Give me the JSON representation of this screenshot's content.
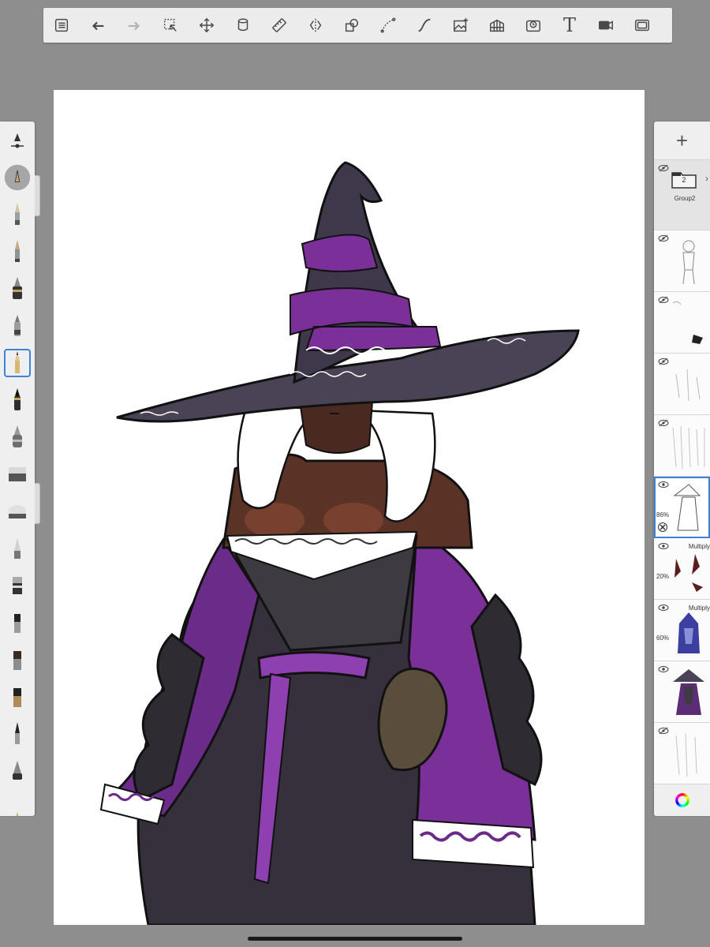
{
  "toolbar": {
    "buttons": [
      {
        "name": "gallery-button",
        "icon": "list-icon"
      },
      {
        "name": "undo-button",
        "icon": "undo-icon"
      },
      {
        "name": "redo-button",
        "icon": "redo-icon",
        "disabled": true
      },
      {
        "name": "selection-button",
        "icon": "selection-icon"
      },
      {
        "name": "transform-button",
        "icon": "move-icon"
      },
      {
        "name": "fill-button",
        "icon": "bucket-icon"
      },
      {
        "name": "ruler-button",
        "icon": "ruler-icon"
      },
      {
        "name": "symmetry-button",
        "icon": "symmetry-icon"
      },
      {
        "name": "shapes-button",
        "icon": "shapes-icon"
      },
      {
        "name": "curve-button",
        "icon": "curve-icon"
      },
      {
        "name": "stroke-button",
        "icon": "stroke-icon"
      },
      {
        "name": "import-image-button",
        "icon": "image-add-icon"
      },
      {
        "name": "perspective-button",
        "icon": "perspective-grid-icon"
      },
      {
        "name": "time-lapse-button",
        "icon": "time-lapse-icon"
      },
      {
        "name": "text-button",
        "icon": "text-icon",
        "glyph": "T"
      },
      {
        "name": "record-button",
        "icon": "video-icon"
      },
      {
        "name": "fullscreen-button",
        "icon": "fullscreen-icon"
      }
    ]
  },
  "brushes": [
    {
      "name": "brush-settings",
      "icon": "brush-settings-icon"
    },
    {
      "name": "brush-color-puck",
      "icon": "color-puck-icon"
    },
    {
      "name": "brush-pencil",
      "icon": "pencil-icon"
    },
    {
      "name": "brush-pencil-2",
      "icon": "pencil-icon"
    },
    {
      "name": "brush-ink-pen",
      "icon": "pen-icon"
    },
    {
      "name": "brush-marker",
      "icon": "marker-icon"
    },
    {
      "name": "brush-pencil-selected",
      "icon": "pencil-icon",
      "selected": true
    },
    {
      "name": "brush-felt-pen",
      "icon": "felt-pen-icon"
    },
    {
      "name": "brush-airbrush",
      "icon": "airbrush-icon"
    },
    {
      "name": "brush-eraser",
      "icon": "eraser-icon"
    },
    {
      "name": "brush-soft-eraser",
      "icon": "eraser-icon"
    },
    {
      "name": "brush-smudge",
      "icon": "smudge-icon"
    },
    {
      "name": "brush-paint-roller",
      "icon": "roller-icon"
    },
    {
      "name": "brush-paint",
      "icon": "paint-brush-icon"
    },
    {
      "name": "brush-flat",
      "icon": "flat-brush-icon"
    },
    {
      "name": "brush-flat-2",
      "icon": "flat-brush-icon"
    },
    {
      "name": "brush-pencil-3",
      "icon": "pencil-icon"
    },
    {
      "name": "brush-fill-tip",
      "icon": "fill-icon"
    },
    {
      "name": "brush-extra",
      "icon": "brush-icon"
    }
  ],
  "layers": {
    "add_label": "+",
    "group": {
      "count": "2",
      "name": "Group2"
    },
    "items": [
      {
        "name": "layer-sketch-boy",
        "opacity": "",
        "blend": "",
        "visible": false,
        "active": false
      },
      {
        "name": "layer-sketch-small",
        "opacity": "",
        "blend": "",
        "visible": false,
        "active": false
      },
      {
        "name": "layer-sketch-figures",
        "opacity": "",
        "blend": "",
        "visible": false,
        "active": false
      },
      {
        "name": "layer-sketch-many",
        "opacity": "",
        "blend": "",
        "visible": false,
        "active": false
      },
      {
        "name": "layer-lineart",
        "opacity": "86%",
        "blend": "",
        "visible": true,
        "active": true
      },
      {
        "name": "layer-multiply-shading",
        "opacity": "20%",
        "blend": "Multiply",
        "visible": true,
        "active": false
      },
      {
        "name": "layer-multiply-blue",
        "opacity": "60%",
        "blend": "Multiply",
        "visible": true,
        "active": false
      },
      {
        "name": "layer-color",
        "opacity": "",
        "blend": "",
        "visible": true,
        "active": false
      },
      {
        "name": "layer-sketch-bottom",
        "opacity": "",
        "blend": "",
        "visible": false,
        "active": false
      }
    ]
  },
  "colors": {
    "accent": "#3b82d8",
    "hat": "#4a4356",
    "sash": "#7a2f99",
    "robe": "#3a3540",
    "skin": "#5a3326",
    "hair": "#ffffff"
  }
}
